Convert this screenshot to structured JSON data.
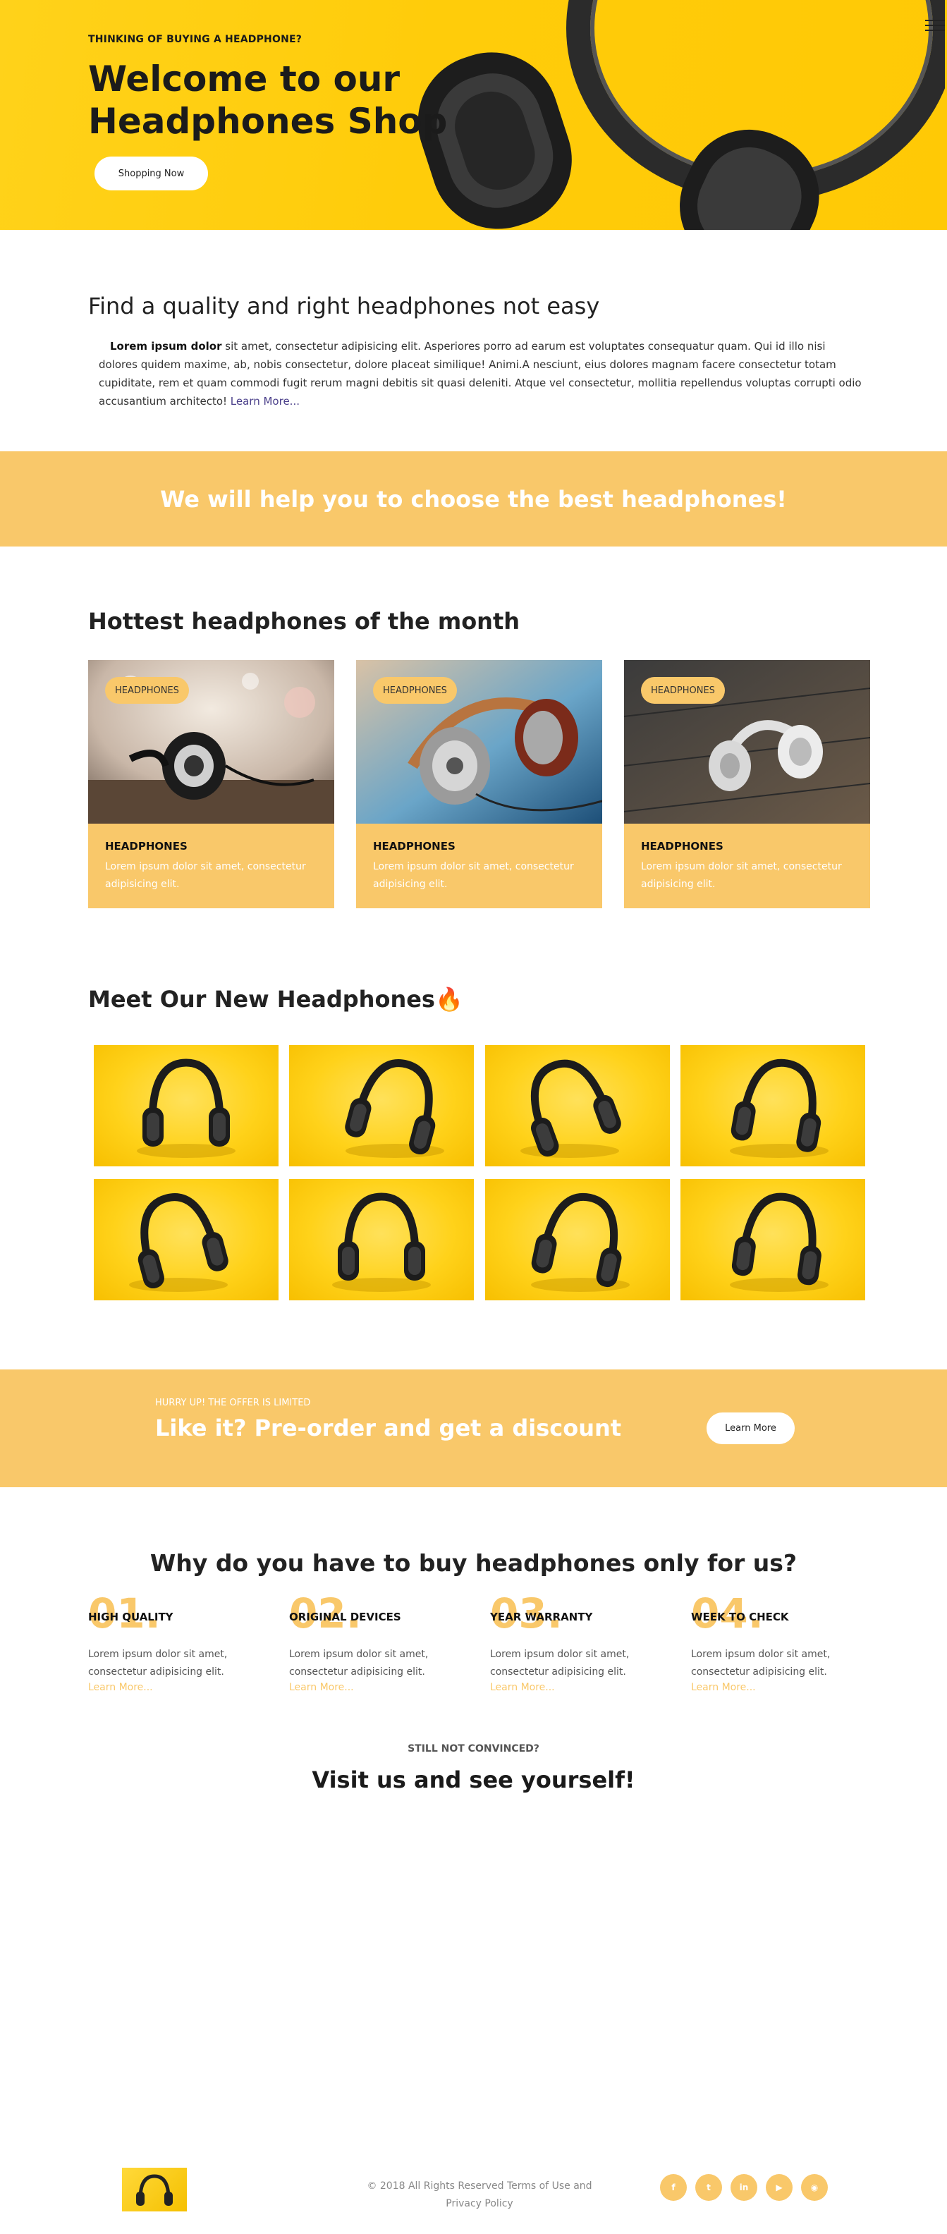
{
  "hero": {
    "kicker": "THINKING OF BUYING A HEADPHONE?",
    "title": "Welcome to our Headphones Shop",
    "button": "Shopping Now"
  },
  "about": {
    "title": "Find a quality and right headphones not easy",
    "lead": "Lorem ipsum dolor",
    "text": " sit amet, consectetur adipisicing elit. Asperiores porro ad earum est voluptates consequatur quam. Qui id illo nisi dolores quidem maxime, ab, nobis consectetur, dolore placeat similique! Animi.A nesciunt, eius dolores magnam facere consectetur totam cupiditate, rem et quam commodi fugit rerum magni debitis sit quasi deleniti. Atque vel consectetur, mollitia repellendus voluptas corrupti odio accusantium architecto! ",
    "link": "Learn More..."
  },
  "banner": {
    "text": "We will help you to choose the best headphones!"
  },
  "hottest": {
    "title": "Hottest headphones of the month",
    "cards": [
      {
        "badge": "HEADPHONES",
        "category": "HEADPHONES",
        "desc": "Lorem ipsum dolor sit amet, consectetur adipisicing elit."
      },
      {
        "badge": "HEADPHONES",
        "category": "HEADPHONES",
        "desc": "Lorem ipsum dolor sit amet, consectetur adipisicing elit."
      },
      {
        "badge": "HEADPHONES",
        "category": "HEADPHONES",
        "desc": "Lorem ipsum dolor sit amet, consectetur adipisicing elit."
      }
    ]
  },
  "newest": {
    "title": "Meet Our New Headphones",
    "emoji": "🔥"
  },
  "offer": {
    "kicker": "HURRY UP! THE OFFER IS LIMITED",
    "title": "Like it? Pre-order and get a discount",
    "button": "Learn More"
  },
  "why": {
    "title": "Why do you have to buy headphones only for us?",
    "items": [
      {
        "num": "01.",
        "head": "HIGH QUALITY",
        "desc": "Lorem ipsum dolor sit amet, consectetur adipisicing elit.",
        "link": "Learn More..."
      },
      {
        "num": "02.",
        "head": "ORIGINAL DEVICES",
        "desc": "Lorem ipsum dolor sit amet, consectetur adipisicing elit.",
        "link": "Learn More..."
      },
      {
        "num": "03.",
        "head": "YEAR WARRANTY",
        "desc": "Lorem ipsum dolor sit amet, consectetur adipisicing elit.",
        "link": "Learn More..."
      },
      {
        "num": "04.",
        "head": "WEEK TO CHECK",
        "desc": "Lorem ipsum dolor sit amet, consectetur adipisicing elit.",
        "link": "Learn More..."
      }
    ]
  },
  "cta": {
    "kicker": "STILL NOT CONVINCED?",
    "title": "Visit us and see yourself!"
  },
  "footer": {
    "copyright": "© 2018 All Rights Reserved Terms of Use and Privacy Policy",
    "socials": [
      {
        "icon": "facebook-icon",
        "glyph": "f"
      },
      {
        "icon": "twitter-icon",
        "glyph": "t"
      },
      {
        "icon": "linkedin-icon",
        "glyph": "in"
      },
      {
        "icon": "youtube-icon",
        "glyph": "▶"
      },
      {
        "icon": "rss-icon",
        "glyph": "◉"
      }
    ]
  },
  "colors": {
    "accent": "#f9c86a",
    "hero_yellow": "#ffcc0a",
    "text_dark": "#1b1b1b"
  }
}
